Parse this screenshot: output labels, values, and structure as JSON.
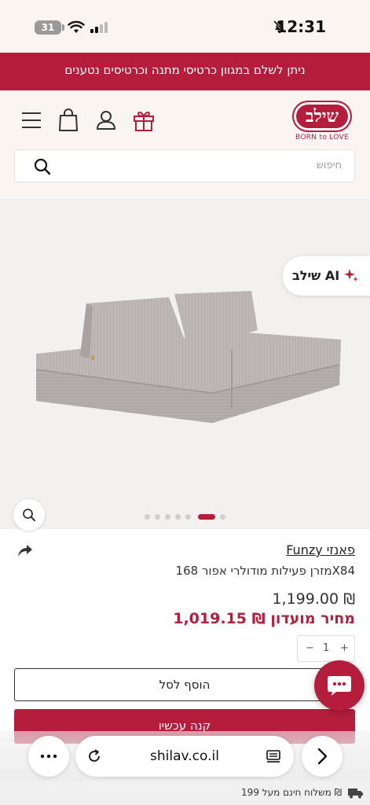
{
  "status_bar": {
    "time": "12:31",
    "battery": "31"
  },
  "promo_banner": {
    "text": "ניתן לשלם במגוון כרטיסי מתנה וכרטיסים נטענים"
  },
  "header": {
    "logo_text": "שילב",
    "logo_tagline": "BORN to LOVE",
    "icons": [
      "menu-icon",
      "bag-icon",
      "user-icon",
      "gift-icon"
    ]
  },
  "search": {
    "placeholder": "חיפוש"
  },
  "gallery": {
    "ai_badge": "שילב AI",
    "slide_count": 7,
    "active_slide": 6
  },
  "product": {
    "brand": "Funzy פאנזי",
    "name": "מזרן פעילות מודולרי אפור 168X84",
    "price": "1,199.00 ₪",
    "club_price": "1,019.15 ₪ מחיר מועדון",
    "quantity": "1",
    "minus": "−",
    "plus": "+",
    "add_to_cart": "הוסף לסל",
    "buy_now": "קנה עכשיו"
  },
  "browser": {
    "url": "shilav.co.il"
  },
  "shipping": {
    "text": "משלוח חינם מעל 199 ₪"
  },
  "colors": {
    "brand": "#b51d3d",
    "background": "#fbf5f1"
  }
}
